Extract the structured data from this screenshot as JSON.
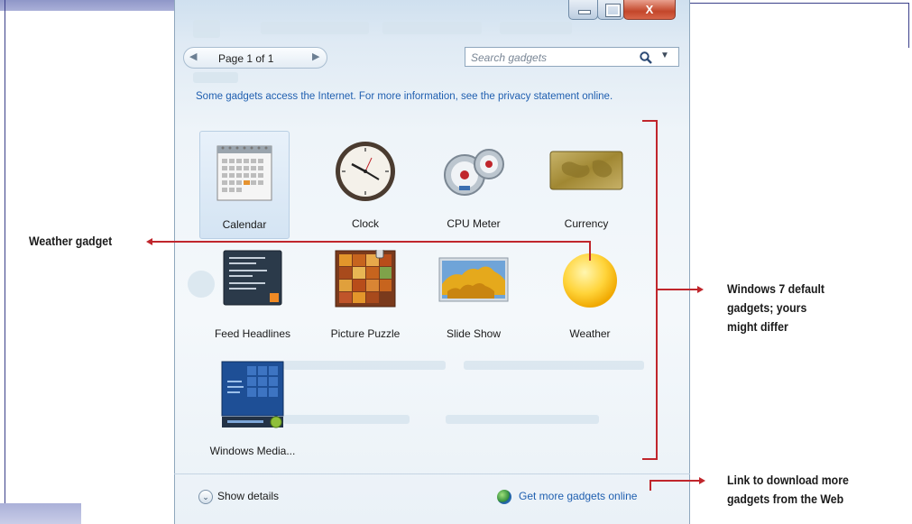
{
  "window": {
    "controls": {
      "minimize": "minimize",
      "maximize": "maximize",
      "close": "X"
    }
  },
  "pager": {
    "label": "Page 1 of 1",
    "prev": "◀",
    "next": "▶"
  },
  "search": {
    "placeholder": "Search gadgets",
    "dropdown": "▼"
  },
  "notice": "Some gadgets access the Internet. For more information, see the privacy statement online.",
  "gadgets": [
    {
      "label": "Calendar",
      "icon": "calendar-icon",
      "selected": true
    },
    {
      "label": "Clock",
      "icon": "clock-icon"
    },
    {
      "label": "CPU Meter",
      "icon": "cpu-meter-icon"
    },
    {
      "label": "Currency",
      "icon": "currency-icon"
    },
    {
      "label": "Feed Headlines",
      "icon": "feed-headlines-icon"
    },
    {
      "label": "Picture Puzzle",
      "icon": "picture-puzzle-icon"
    },
    {
      "label": "Slide Show",
      "icon": "slide-show-icon"
    },
    {
      "label": "Weather",
      "icon": "weather-icon"
    },
    {
      "label": "Windows Media...",
      "icon": "windows-media-icon"
    }
  ],
  "footer": {
    "show_details": "Show details",
    "show_details_glyph": "⌄",
    "get_more": "Get more gadgets online"
  },
  "callouts": {
    "weather": "Weather gadget",
    "defaults": [
      "Windows 7 default",
      "gadgets; yours",
      "might differ"
    ],
    "download": [
      "Link to download more",
      "gadgets from the Web"
    ]
  },
  "colors": {
    "callout_line": "#c0262c",
    "link": "#1f5fb0",
    "accent_close": "#c3462a"
  }
}
